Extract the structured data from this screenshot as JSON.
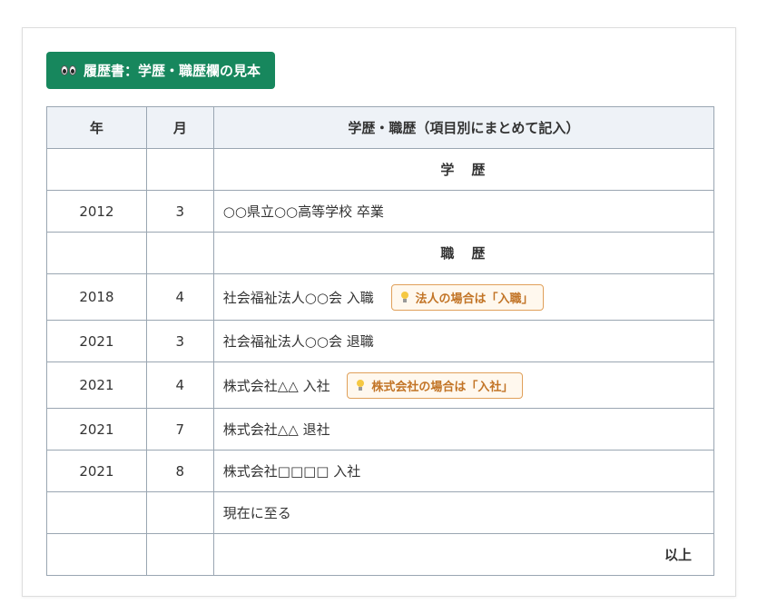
{
  "title": "履歴書：学歴・職歴欄の見本",
  "title_icon": "eyes-icon",
  "colors": {
    "title_bg": "#17875d",
    "header_bg": "#eef2f7",
    "tip_border": "#e0a05a",
    "tip_text": "#c27426",
    "border": "#9aa6b2"
  },
  "table": {
    "headers": {
      "year": "年",
      "month": "月",
      "detail": "学歴・職歴（項目別にまとめて記入）"
    },
    "rows": [
      {
        "year": "",
        "month": "",
        "detail": "学　歴",
        "kind": "section"
      },
      {
        "year": "2012",
        "month": "3",
        "detail": "○○県立○○高等学校 卒業"
      },
      {
        "year": "",
        "month": "",
        "detail": "職　歴",
        "kind": "section"
      },
      {
        "year": "2018",
        "month": "4",
        "detail": "社会福祉法人○○会 入職",
        "tip": "法人の場合は「入職」"
      },
      {
        "year": "2021",
        "month": "3",
        "detail": "社会福祉法人○○会 退職"
      },
      {
        "year": "2021",
        "month": "4",
        "detail": "株式会社△△ 入社",
        "tip": "株式会社の場合は「入社」"
      },
      {
        "year": "2021",
        "month": "7",
        "detail": "株式会社△△ 退社"
      },
      {
        "year": "2021",
        "month": "8",
        "detail": "株式会社□□□□ 入社"
      },
      {
        "year": "",
        "month": "",
        "detail": "現在に至る"
      },
      {
        "year": "",
        "month": "",
        "detail": "以上",
        "kind": "end"
      }
    ]
  }
}
